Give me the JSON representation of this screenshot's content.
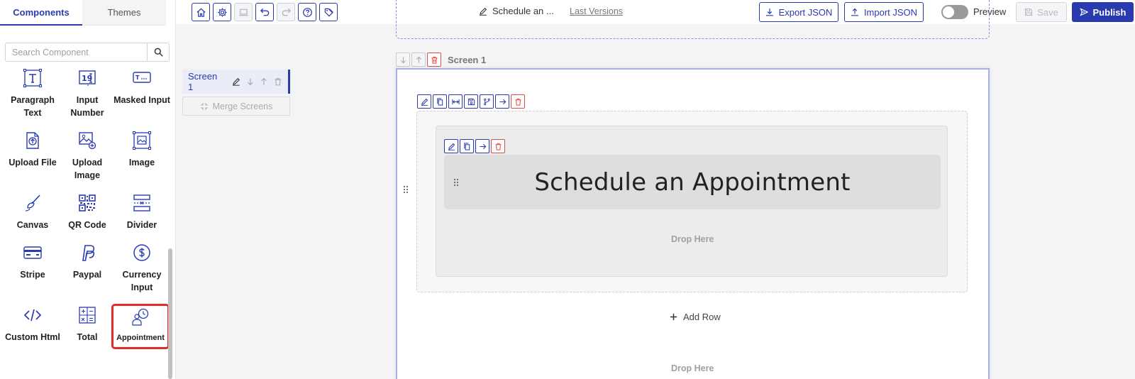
{
  "panel": {
    "tabs": [
      {
        "label": "Components",
        "active": true
      },
      {
        "label": "Themes",
        "active": false
      }
    ],
    "search": {
      "placeholder": "Search Component",
      "value": ""
    },
    "components": [
      {
        "label": "Paragraph Text",
        "icon": "text-icon"
      },
      {
        "label": "Input Number",
        "icon": "number-input-icon"
      },
      {
        "label": "Masked Input",
        "icon": "masked-input-icon"
      },
      {
        "label": "Upload File",
        "icon": "upload-file-icon"
      },
      {
        "label": "Upload Image",
        "icon": "upload-image-icon"
      },
      {
        "label": "Image",
        "icon": "image-icon"
      },
      {
        "label": "Canvas",
        "icon": "brush-icon"
      },
      {
        "label": "QR Code",
        "icon": "qr-code-icon"
      },
      {
        "label": "Divider",
        "icon": "divider-icon"
      },
      {
        "label": "Stripe",
        "icon": "credit-card-icon"
      },
      {
        "label": "Paypal",
        "icon": "paypal-icon"
      },
      {
        "label": "Currency Input",
        "icon": "dollar-icon"
      },
      {
        "label": "Custom Html",
        "icon": "code-icon"
      },
      {
        "label": "Total",
        "icon": "calculator-icon"
      },
      {
        "label": "Appointment",
        "icon": "appointment-icon",
        "selected": true
      }
    ]
  },
  "toolbar": {
    "form_title": "Schedule an ...",
    "last_versions": "Last Versions",
    "export_label": "Export JSON",
    "import_label": "Import JSON",
    "preview_label": "Preview",
    "preview_on": false,
    "save_label": "Save",
    "publish_label": "Publish"
  },
  "screens": {
    "items": [
      {
        "label": "Screen 1"
      }
    ],
    "merge_label": "Merge Screens"
  },
  "canvas": {
    "screen_label": "Screen 1",
    "heading_text": "Schedule an Appointment",
    "drop_here_inner": "Drop Here",
    "add_row_label": "Add Row",
    "drop_here_outer": "Drop Here"
  },
  "colors": {
    "accent": "#2a3bb0",
    "danger": "#e24a4a",
    "selected_outline": "#e02b2b"
  }
}
